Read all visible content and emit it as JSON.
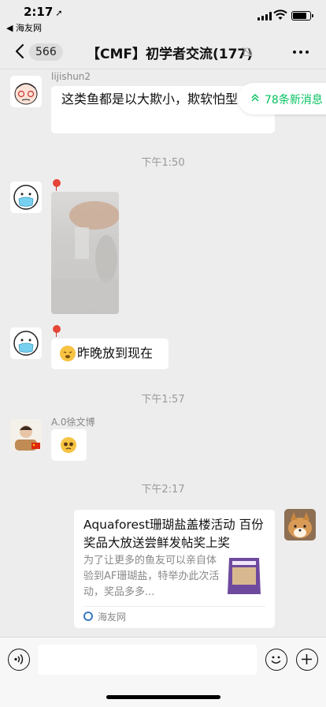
{
  "status_bar": {
    "time": "2:17",
    "back_app": "◀ 海友网"
  },
  "nav": {
    "unread_count": "566",
    "title": "【CMF】初学者交流(177)"
  },
  "new_messages_label": "78条新消息",
  "messages": [
    {
      "sender": "lijishun2",
      "text": "这类鱼都是以大欺小，欺软怕型"
    },
    {
      "type": "image"
    },
    {
      "text": "昨晚放到现在"
    },
    {
      "sender": "A.0徐文博",
      "type": "emoji"
    },
    {
      "type": "link",
      "title": "Aquaforest珊瑚盐盖楼活动 百份奖品大放送尝鲜发帖奖上奖",
      "description": "为了让更多的鱼友可以亲自体验到AF珊瑚盐，特举办此次活动，奖品多多...",
      "source": "海友网"
    }
  ],
  "timestamps": [
    "下午1:50",
    "下午1:57",
    "下午2:17"
  ],
  "colors": {
    "background": "#ededed",
    "accent": "#07c160",
    "bubble": "#ffffff"
  },
  "icons": [
    "back-chevron",
    "mute-icon",
    "more-icon",
    "voice-icon",
    "emoji-icon",
    "plus-icon",
    "double-chevron-up"
  ]
}
